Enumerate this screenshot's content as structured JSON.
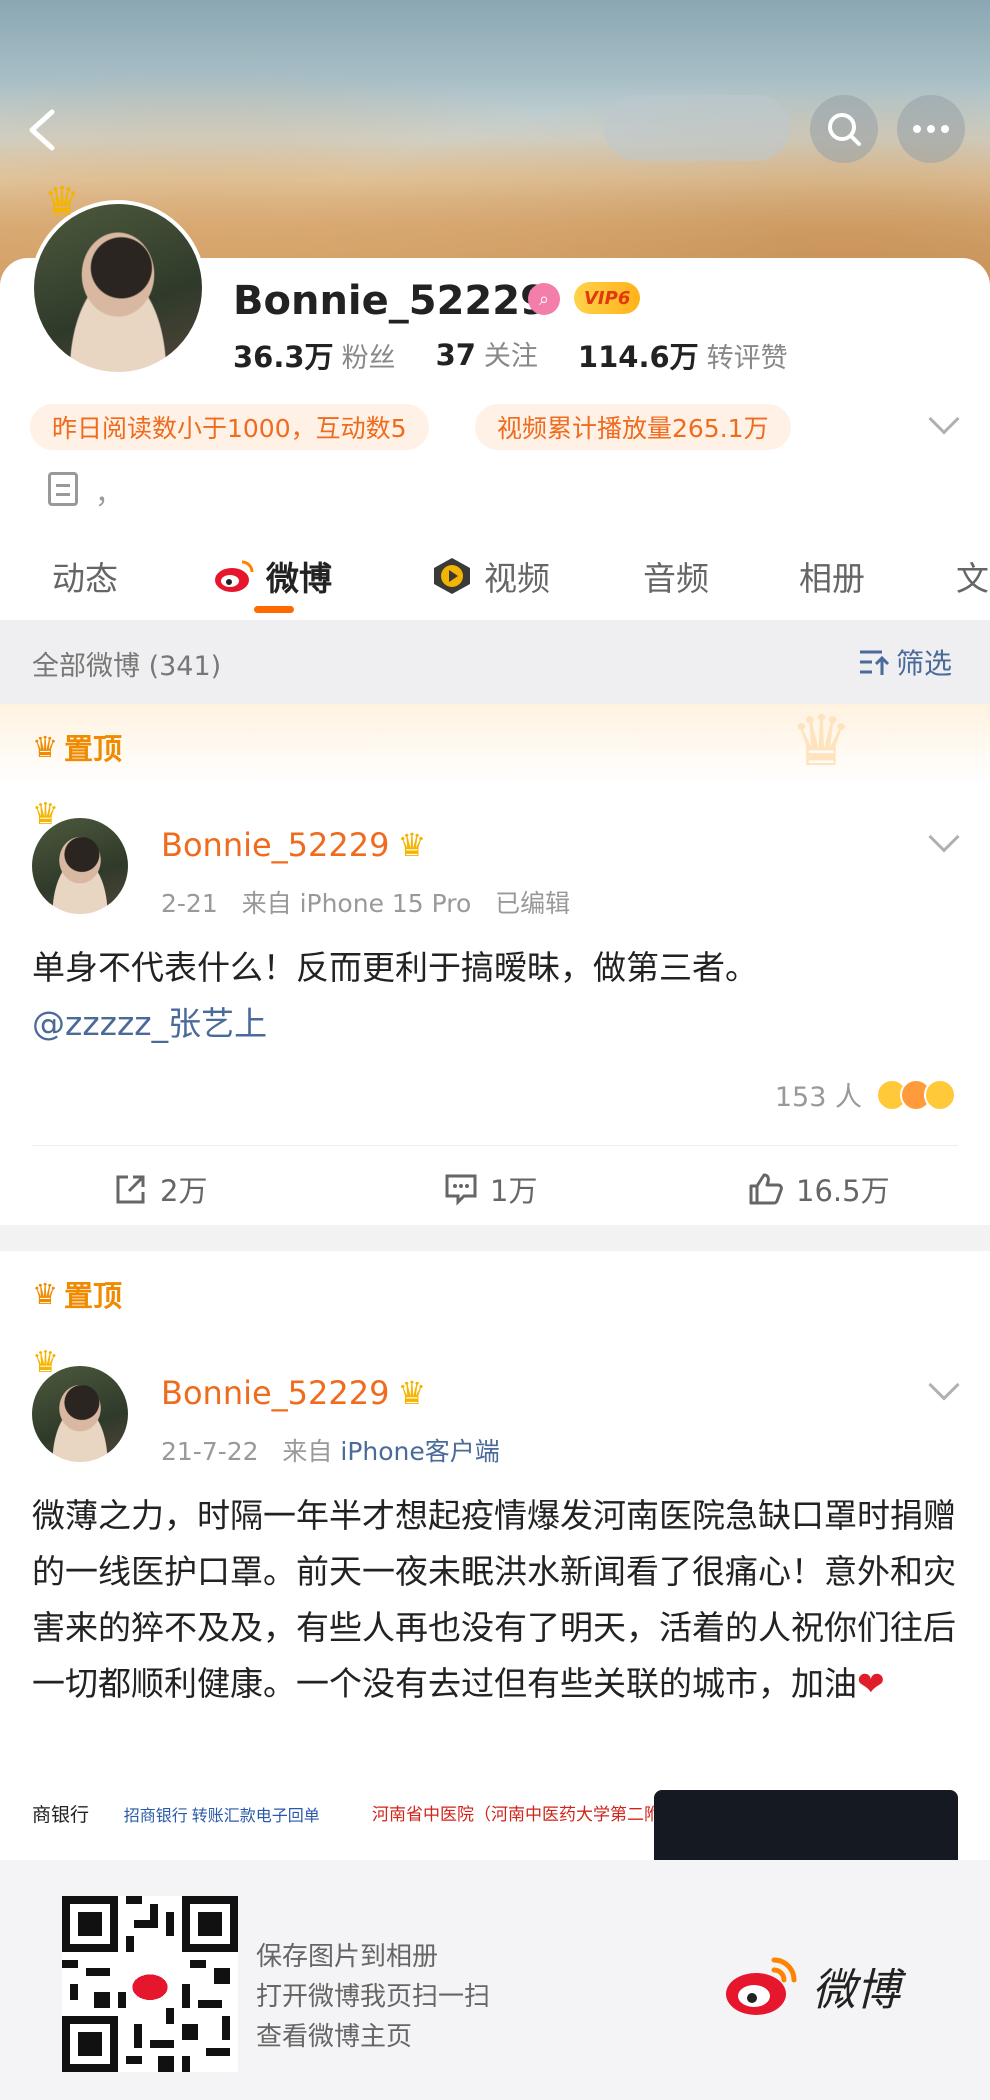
{
  "profile": {
    "username": "Bonnie_52229",
    "vip_label": "VIP6",
    "followers_count": "36.3万",
    "followers_label": "粉丝",
    "following_count": "37",
    "following_label": "关注",
    "interactions_count": "114.6万",
    "interactions_label": "转评赞",
    "tags": [
      "昨日阅读数小于1000，互动数5",
      "视频累计播放量265.1万"
    ],
    "bio": "，"
  },
  "tabs": [
    "动态",
    "微博",
    "视频",
    "音频",
    "相册",
    "文"
  ],
  "list": {
    "title": "全部微博 (341)",
    "filter_label": "筛选"
  },
  "posts": [
    {
      "pinned_label": "置顶",
      "author": "Bonnie_52229",
      "date": "2-21",
      "source_prefix": "来自",
      "source": "iPhone 15 Pro",
      "edited": "已编辑",
      "text": "单身不代表什么！反而更利于搞暧昧，做第三者。",
      "mention": "@zzzzz_张艺上",
      "reaction_count": "153 人",
      "reposts": "2万",
      "comments": "1万",
      "likes": "16.5万"
    },
    {
      "pinned_label": "置顶",
      "author": "Bonnie_52229",
      "date": "21-7-22",
      "source_prefix": "来自",
      "source": "iPhone客户端",
      "text": "微薄之力，时隔一年半才想起疫情爆发河南医院急缺口罩时捐赠的一线医护口罩。前天一夜未眠洪水新闻看了很痛心！意外和灾害来的猝不及及，有些人再也没有了明天，活着的人祝你们往后一切都顺利健康。一个没有去过但有些关联的城市，加油"
    }
  ],
  "thumbnails": {
    "bank_name": "商银行",
    "bank_receipt": "招商银行 转账汇款电子回单",
    "hospital": "河南省中医院（河南中医药大学第二附属医院）"
  },
  "qr_panel": {
    "lines": [
      "保存图片到相册",
      "打开微博我页扫一扫",
      "查看微博主页"
    ],
    "logo_text": "微博"
  },
  "colors": {
    "accent": "#ef6b1d",
    "link": "#4a6a9a",
    "pin": "#f08a00",
    "tab_indicator": "#ff6a00"
  }
}
